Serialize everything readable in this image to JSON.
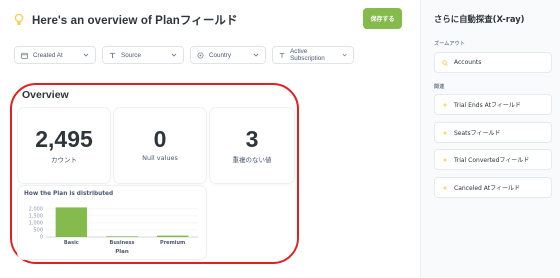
{
  "header": {
    "title": "Here's an overview of Planフィールド",
    "save_label": "保存する"
  },
  "filters": [
    {
      "label": "Created At",
      "icon": "calendar-icon"
    },
    {
      "label": "Source",
      "icon": "text-icon"
    },
    {
      "label": "Country",
      "icon": "location-icon"
    },
    {
      "label": "Active Subscription",
      "icon": "text-icon"
    }
  ],
  "overview": {
    "title": "Overview",
    "metrics": [
      {
        "value": "2,495",
        "label": "カウント"
      },
      {
        "value": "0",
        "label": "Null values"
      },
      {
        "value": "3",
        "label": "重複のない値"
      }
    ],
    "chart_title": "How the Plan is distributed"
  },
  "chart_data": {
    "type": "bar",
    "title": "How the Plan is distributed",
    "categories": [
      "Basic",
      "Business",
      "Premium"
    ],
    "values": [
      2100,
      50,
      100
    ],
    "xlabel": "Plan",
    "ylabel": "",
    "yticks": [
      "2,000",
      "1,500",
      "1,000",
      "500",
      "0"
    ],
    "ylim": [
      0,
      2200
    ],
    "color": "#84bb4c"
  },
  "sidebar": {
    "title": "さらに自動探査(X-ray)",
    "zoom_label": "ズームアウト",
    "zoom_items": [
      {
        "label": "Accounts"
      }
    ],
    "related_label": "関連",
    "related_items": [
      {
        "label": "Trial Ends Atフィールド"
      },
      {
        "label": "Seatsフィールド"
      },
      {
        "label": "Trial Convertedフィールド"
      },
      {
        "label": "Canceled Atフィールド"
      }
    ]
  },
  "colors": {
    "accent_green": "#84bb4c",
    "highlight_red": "#e02020",
    "icon_yellow": "#f9cf48"
  }
}
